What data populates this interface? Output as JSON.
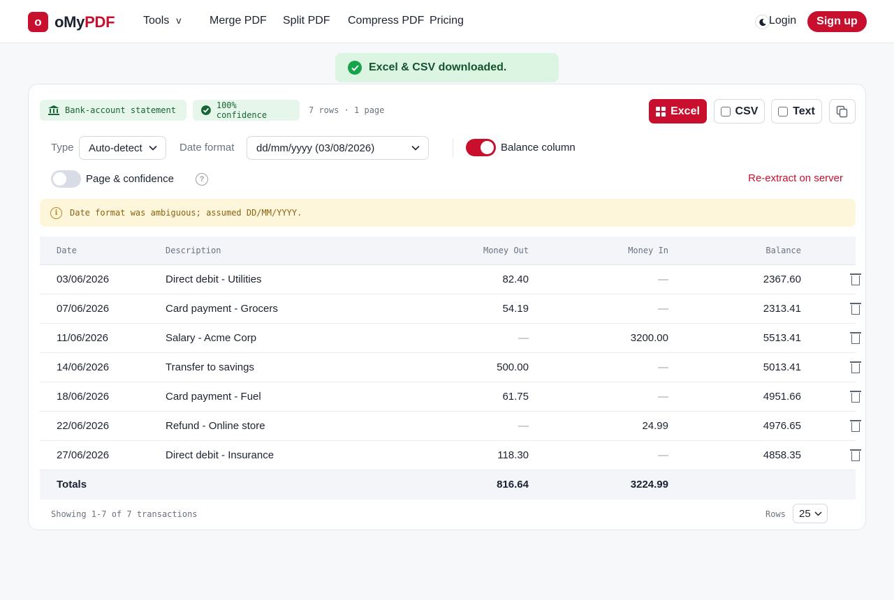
{
  "header": {
    "logo_mark": "o",
    "logo_prefix": "oMy",
    "logo_suffix": "PDF",
    "nav": {
      "tools": "Tools",
      "tools_chevron": "v",
      "merge": "Merge PDF",
      "split": "Split PDF",
      "compress": "Compress PDF",
      "pricing": "Pricing"
    },
    "login": "Login",
    "signup": "Sign up"
  },
  "toast": {
    "text": "Excel & CSV downloaded."
  },
  "card": {
    "doc_type": "Bank-account statement",
    "confidence": "100% confidence",
    "meta": "7 rows · 1 page",
    "export": {
      "excel": "Excel",
      "csv": "CSV",
      "text": "Text"
    },
    "controls": {
      "type_label": "Type",
      "type_value": "Auto-detect",
      "date_label": "Date format",
      "date_value": "dd/mm/yyyy (03/08/2026)",
      "balance_label": "Balance column",
      "balance_on": true,
      "page_conf_label": "Page & confidence",
      "page_conf_on": false,
      "help": "?",
      "reextract": "Re-extract on server"
    },
    "warning": {
      "icon": "i",
      "text": "Date format was ambiguous; assumed DD/MM/YYYY."
    }
  },
  "table": {
    "headers": {
      "date": "Date",
      "description": "Description",
      "money_out": "Money Out",
      "money_in": "Money In",
      "balance": "Balance"
    },
    "rows": [
      {
        "date": "03/06/2026",
        "description": "Direct debit - Utilities",
        "money_out": "82.40",
        "money_in": "—",
        "balance": "2367.60"
      },
      {
        "date": "07/06/2026",
        "description": "Card payment - Grocers",
        "money_out": "54.19",
        "money_in": "—",
        "balance": "2313.41"
      },
      {
        "date": "11/06/2026",
        "description": "Salary - Acme Corp",
        "money_out": "—",
        "money_in": "3200.00",
        "balance": "5513.41"
      },
      {
        "date": "14/06/2026",
        "description": "Transfer to savings",
        "money_out": "500.00",
        "money_in": "—",
        "balance": "5013.41"
      },
      {
        "date": "18/06/2026",
        "description": "Card payment - Fuel",
        "money_out": "61.75",
        "money_in": "—",
        "balance": "4951.66"
      },
      {
        "date": "22/06/2026",
        "description": "Refund - Online store",
        "money_out": "—",
        "money_in": "24.99",
        "balance": "4976.65"
      },
      {
        "date": "27/06/2026",
        "description": "Direct debit - Insurance",
        "money_out": "118.30",
        "money_in": "—",
        "balance": "4858.35"
      }
    ],
    "totals": {
      "label": "Totals",
      "money_out": "816.64",
      "money_in": "3224.99"
    }
  },
  "footer": {
    "showing": "Showing 1-7 of 7 transactions",
    "rows_label": "Rows",
    "rows_value": "25"
  },
  "colors": {
    "brand": "#c8102e",
    "success": "#17a34a",
    "warning_bg": "#fdf6da"
  },
  "icons": {
    "toast": "check-circle-icon",
    "doc_type": "bank-icon",
    "confidence": "check-circle-icon",
    "excel": "grid-icon",
    "copy": "copy-icon",
    "theme": "moon-icon",
    "row_action": "trash-icon"
  }
}
